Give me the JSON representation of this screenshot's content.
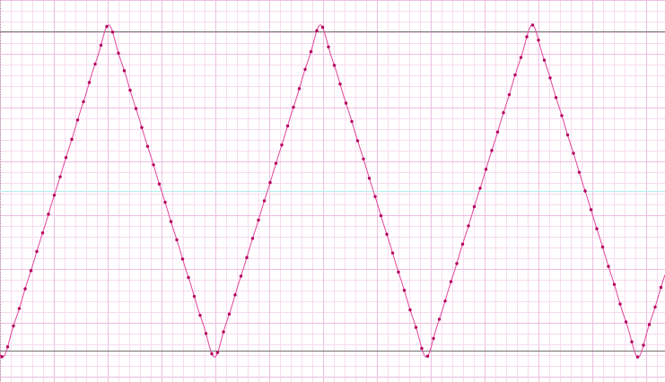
{
  "chart_data": {
    "type": "line",
    "title": "",
    "xlabel": "",
    "ylabel": "",
    "x_range": [
      0,
      741
    ],
    "ylim": [
      -1.2,
      1.2
    ],
    "period": 236,
    "grid": true,
    "legend": "none",
    "reference_lines": [
      {
        "name": "upper-limit",
        "y": 1.0
      },
      {
        "name": "zero-line",
        "y": 0.0
      },
      {
        "name": "lower-limit",
        "y": -1.0
      }
    ],
    "series": [
      {
        "kind": "truncated-fourier-curve",
        "harmonics": 7,
        "sample_step": 6.5
      }
    ],
    "colors": {
      "curve": "#e0449a",
      "marker": "#b5005e",
      "grid_minor": "#f6dcef",
      "grid_major": "#eebfe0",
      "limit_line": "#707070",
      "zero_line": "#aef2ec",
      "left_axis": "#9a9a9a"
    }
  }
}
